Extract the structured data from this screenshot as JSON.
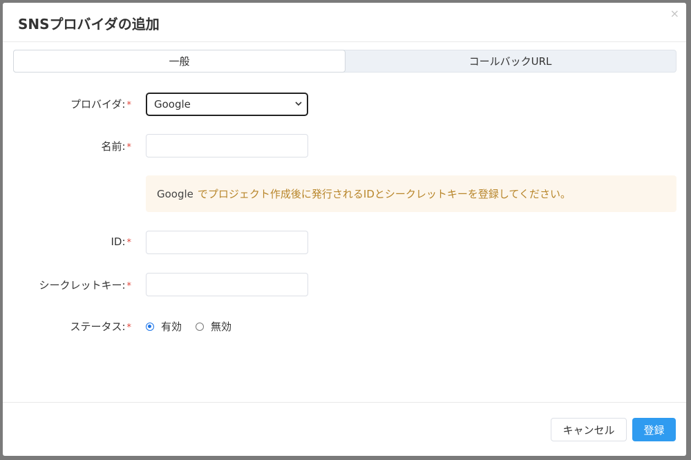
{
  "modal": {
    "title": "SNSプロバイダの追加",
    "close_glyph": "×"
  },
  "tabs": [
    {
      "label": "一般",
      "active": true
    },
    {
      "label": "コールバックURL",
      "active": false
    }
  ],
  "form": {
    "required_mark": "*",
    "provider": {
      "label": "プロバイダ:",
      "value": "Google"
    },
    "name": {
      "label": "名前:",
      "value": ""
    },
    "notice": {
      "prefix": "Google",
      "message": "でプロジェクト作成後に発行されるIDとシークレットキーを登録してください。"
    },
    "id": {
      "label": "ID:",
      "value": ""
    },
    "secret": {
      "label": "シークレットキー:",
      "value": ""
    },
    "status": {
      "label": "ステータス:",
      "options": [
        {
          "label": "有効",
          "checked": true
        },
        {
          "label": "無効",
          "checked": false
        }
      ]
    }
  },
  "footer": {
    "cancel_label": "キャンセル",
    "submit_label": "登録"
  },
  "colors": {
    "accent": "#2f9bf0",
    "required": "#e0453a",
    "notice_bg": "#fdf6ec",
    "notice_text": "#b8862b"
  },
  "icons": {
    "close": "close-icon",
    "select_caret": "chevron-down-icon"
  }
}
